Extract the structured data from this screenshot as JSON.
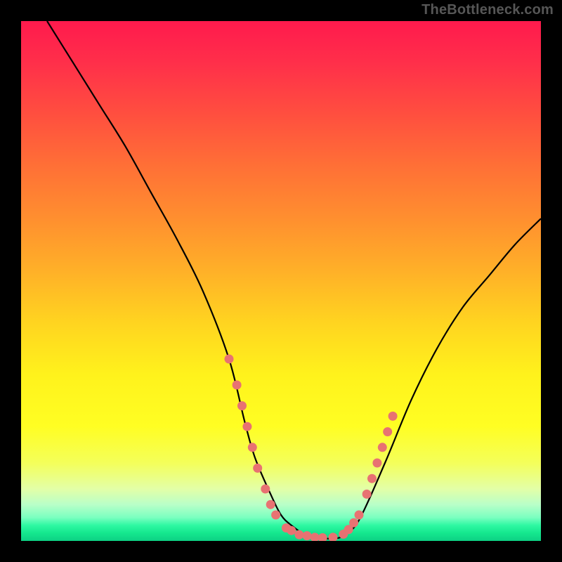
{
  "watermark": "TheBottleneck.com",
  "chart_data": {
    "type": "line",
    "title": "",
    "xlabel": "",
    "ylabel": "",
    "xlim": [
      0,
      100
    ],
    "ylim": [
      0,
      100
    ],
    "series": [
      {
        "name": "curve",
        "color": "#000000",
        "x": [
          5,
          10,
          15,
          20,
          25,
          30,
          35,
          40,
          43,
          45,
          48,
          50,
          52,
          55,
          58,
          60,
          62,
          65,
          70,
          75,
          80,
          85,
          90,
          95,
          100
        ],
        "y": [
          100,
          92,
          84,
          76,
          67,
          58,
          48,
          35,
          23,
          16,
          9,
          5,
          3,
          1,
          0.5,
          0.5,
          1,
          4,
          15,
          27,
          37,
          45,
          51,
          57,
          62
        ]
      }
    ],
    "markers": [
      {
        "x": 40,
        "y": 35
      },
      {
        "x": 41.5,
        "y": 30
      },
      {
        "x": 42.5,
        "y": 26
      },
      {
        "x": 43.5,
        "y": 22
      },
      {
        "x": 44.5,
        "y": 18
      },
      {
        "x": 45.5,
        "y": 14
      },
      {
        "x": 47,
        "y": 10
      },
      {
        "x": 48,
        "y": 7
      },
      {
        "x": 49,
        "y": 5
      },
      {
        "x": 51,
        "y": 2.5
      },
      {
        "x": 52,
        "y": 2
      },
      {
        "x": 53.5,
        "y": 1.2
      },
      {
        "x": 55,
        "y": 1
      },
      {
        "x": 56.5,
        "y": 0.7
      },
      {
        "x": 58,
        "y": 0.6
      },
      {
        "x": 60,
        "y": 0.7
      },
      {
        "x": 62,
        "y": 1.3
      },
      {
        "x": 63,
        "y": 2.2
      },
      {
        "x": 64,
        "y": 3.5
      },
      {
        "x": 65,
        "y": 5
      },
      {
        "x": 66.5,
        "y": 9
      },
      {
        "x": 67.5,
        "y": 12
      },
      {
        "x": 68.5,
        "y": 15
      },
      {
        "x": 69.5,
        "y": 18
      },
      {
        "x": 70.5,
        "y": 21
      },
      {
        "x": 71.5,
        "y": 24
      }
    ],
    "marker_color": "#e87272",
    "gradient_colors": {
      "top": "#ff1a4d",
      "mid": "#ffeb20",
      "bottom": "#0dd084"
    }
  }
}
